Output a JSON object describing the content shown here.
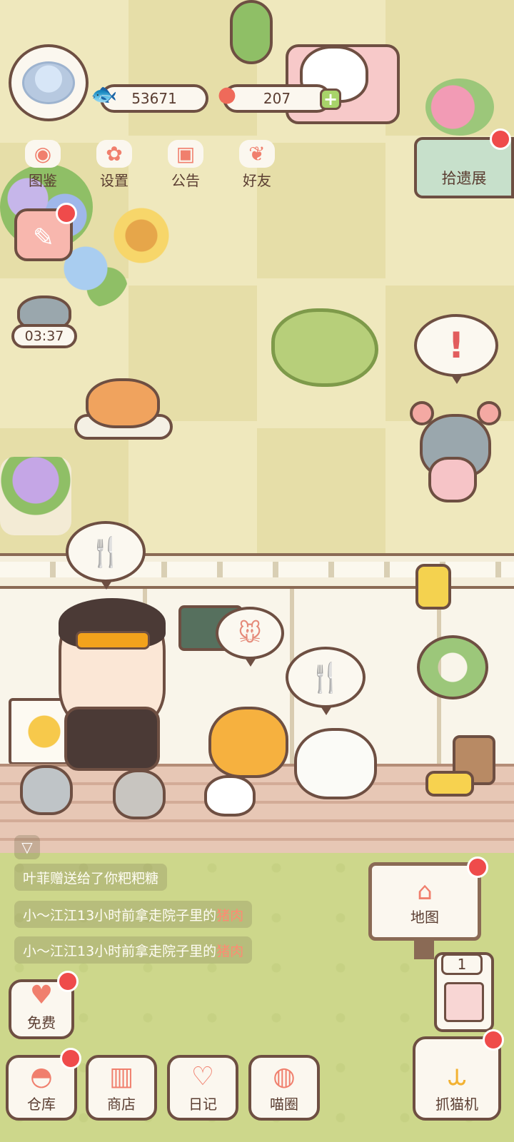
{
  "colors": {
    "accent": "#f07f6d",
    "outline": "#6e4f42",
    "badge": "#ef4b4b",
    "grass": "#cdd78b",
    "floor": "#efe8bd"
  },
  "currency": {
    "fish": {
      "icon": "fish-icon",
      "value": "53671"
    },
    "tomato": {
      "icon": "tomato-icon",
      "value": "207"
    }
  },
  "top_menu": [
    {
      "label": "图鉴",
      "icon": "cat-face-icon"
    },
    {
      "label": "设置",
      "icon": "gear-icon"
    },
    {
      "label": "公告",
      "icon": "gift-icon"
    },
    {
      "label": "好友",
      "icon": "friends-icon"
    }
  ],
  "lost_exhibit": {
    "label": "拾遗展"
  },
  "timer": {
    "value": "03:37"
  },
  "feed": [
    {
      "prefix": "叶菲赠送给了你粑粑糖",
      "highlight": ""
    },
    {
      "prefix": "小～江江13小时前拿走院子里的",
      "highlight": "猪肉"
    },
    {
      "prefix": "小～江江13小时前拿走院子里的",
      "highlight": "猪肉"
    }
  ],
  "map_sign": {
    "label": "地图",
    "icon": "house-icon"
  },
  "slot": {
    "count": "1"
  },
  "free_button": {
    "label": "免费",
    "icon": "heart-icon"
  },
  "bottom_nav": [
    {
      "label": "仓库",
      "icon": "bowl-icon"
    },
    {
      "label": "商店",
      "icon": "shop-icon"
    },
    {
      "label": "日记",
      "icon": "diary-icon"
    },
    {
      "label": "喵圈",
      "icon": "planet-cat-icon"
    }
  ],
  "claw_machine": {
    "label": "抓猫机",
    "icon": "claw-icon"
  },
  "bubbles": {
    "alert": "!",
    "food": "🍴",
    "mouse": "🐭"
  }
}
